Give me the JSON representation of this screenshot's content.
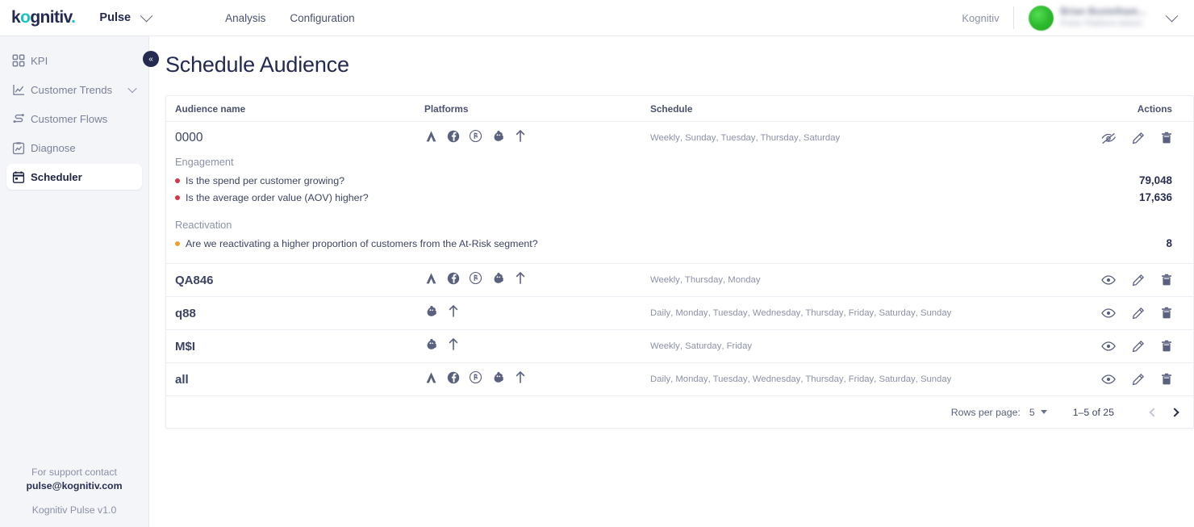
{
  "topbar": {
    "logo": "kognitiv",
    "logo_accent_color": "#17c3c3",
    "app_name": "Pulse",
    "app_switch_icon": "chevron-down-icon",
    "nav": [
      {
        "label": "Analysis"
      },
      {
        "label": "Configuration"
      }
    ],
    "tenant": "Kognitiv",
    "account": {
      "name": "Brian Bustelham...",
      "role": "Pulse Platform Admin",
      "avatar_color": "#2fbb2f",
      "menu_icon": "chevron-down-icon"
    }
  },
  "sidebar": {
    "collapse_button": "«",
    "items": [
      {
        "label": "KPI",
        "icon": "dashboard-grid-icon",
        "active": false,
        "expandable": false
      },
      {
        "label": "Customer Trends",
        "icon": "line-chart-icon",
        "active": false,
        "expandable": true
      },
      {
        "label": "Customer Flows",
        "icon": "flow-nodes-icon",
        "active": false,
        "expandable": false
      },
      {
        "label": "Diagnose",
        "icon": "clipboard-chart-icon",
        "active": false,
        "expandable": false
      },
      {
        "label": "Scheduler",
        "icon": "calendar-icon",
        "active": true,
        "expandable": false
      }
    ],
    "support": {
      "line1": "For support contact",
      "email": "pulse@kognitiv.com",
      "product": "Kognitiv Pulse",
      "version": "v1.0"
    }
  },
  "page": {
    "title": "Schedule Audience"
  },
  "table": {
    "columns": {
      "name": "Audience name",
      "platforms": "Platforms",
      "schedule": "Schedule",
      "actions": "Actions"
    },
    "rows": [
      {
        "name": "0000",
        "platforms": [
          "attentive-icon",
          "facebook-icon",
          "bloomreach-icon",
          "mailchimp-icon",
          "klaviyo-icon"
        ],
        "schedule": [
          "Weekly",
          "Sunday",
          "Tuesday",
          "Thursday",
          "Saturday"
        ],
        "visibility_icon": "eye-off-icon",
        "edit_icon": "pencil-icon",
        "delete_icon": "trash-icon",
        "expanded": true,
        "groups": [
          {
            "title": "Engagement",
            "questions": [
              {
                "text": "Is the spend per customer growing?",
                "dot_color": "#d63649",
                "value": "79,048"
              },
              {
                "text": "Is the average order value (AOV) higher?",
                "dot_color": "#d63649",
                "value": "17,636"
              }
            ]
          },
          {
            "title": "Reactivation",
            "questions": [
              {
                "text": "Are we reactivating a higher proportion of customers from the At-Risk segment?",
                "dot_color": "#f0a030",
                "value": "8"
              }
            ]
          }
        ]
      },
      {
        "name": "QA846",
        "platforms": [
          "attentive-icon",
          "facebook-icon",
          "bloomreach-icon",
          "mailchimp-icon",
          "klaviyo-icon"
        ],
        "schedule": [
          "Weekly",
          "Thursday",
          "Monday"
        ],
        "visibility_icon": "eye-icon",
        "edit_icon": "pencil-icon",
        "delete_icon": "trash-icon",
        "expanded": false,
        "groups": []
      },
      {
        "name": "q88",
        "platforms": [
          "mailchimp-icon",
          "klaviyo-icon"
        ],
        "schedule": [
          "Daily",
          "Monday",
          "Tuesday",
          "Wednesday",
          "Thursday",
          "Friday",
          "Saturday",
          "Sunday"
        ],
        "visibility_icon": "eye-icon",
        "edit_icon": "pencil-icon",
        "delete_icon": "trash-icon",
        "expanded": false,
        "groups": []
      },
      {
        "name": "M$I",
        "platforms": [
          "mailchimp-icon",
          "klaviyo-icon"
        ],
        "schedule": [
          "Weekly",
          "Saturday",
          "Friday"
        ],
        "visibility_icon": "eye-icon",
        "edit_icon": "pencil-icon",
        "delete_icon": "trash-icon",
        "expanded": false,
        "groups": []
      },
      {
        "name": "all",
        "platforms": [
          "attentive-icon",
          "facebook-icon",
          "bloomreach-icon",
          "mailchimp-icon",
          "klaviyo-icon"
        ],
        "schedule": [
          "Daily",
          "Monday",
          "Tuesday",
          "Wednesday",
          "Thursday",
          "Friday",
          "Saturday",
          "Sunday"
        ],
        "visibility_icon": "eye-icon",
        "edit_icon": "pencil-icon",
        "delete_icon": "trash-icon",
        "expanded": false,
        "groups": []
      }
    ],
    "pagination": {
      "rows_per_page_label": "Rows per page:",
      "rows_per_page_value": "5",
      "range": "1–5 of 25",
      "prev_icon": "chevron-left-icon",
      "next_icon": "chevron-right-icon"
    }
  }
}
